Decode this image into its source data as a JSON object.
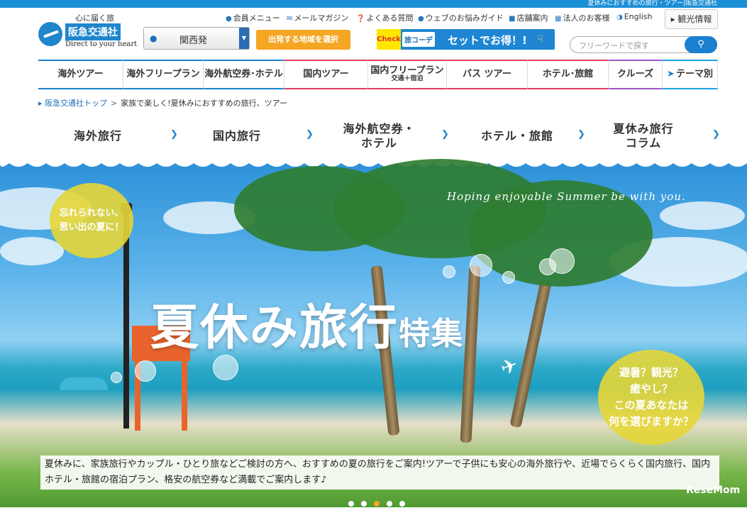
{
  "header": {
    "topbar_text": "夏休みにおすすめの旅行・ツアー|阪急交通社",
    "logo_tagline": "心に届く旅",
    "logo_name": "阪急交通社",
    "logo_english": "Direct to your heart",
    "region_value": "関西発",
    "region_button": "出発する地域を選択",
    "banner_check": "Check",
    "banner_brand": "旅コーデ",
    "banner_text": "セットでお得！!",
    "util_links": [
      "会員メニュー",
      "メールマガジン",
      "よくある質問",
      "ウェブのお悩みガイド",
      "店舗案内",
      "法人のお客様",
      "English"
    ],
    "kanko_button": "観光情報",
    "search_placeholder": "フリーワードで探す"
  },
  "global_nav": [
    {
      "label": "海外ツアー",
      "sub": ""
    },
    {
      "label": "海外フリープラン",
      "sub": ""
    },
    {
      "label": "海外航空券･ホテル",
      "sub": ""
    },
    {
      "label": "国内ツアー",
      "sub": ""
    },
    {
      "label": "国内フリープラン",
      "sub": "交通＋宿泊"
    },
    {
      "label": "バス ツアー",
      "sub": ""
    },
    {
      "label": "ホテル･旅館",
      "sub": ""
    },
    {
      "label": "クルーズ",
      "sub": ""
    },
    {
      "label": "テーマ別",
      "sub": ""
    }
  ],
  "breadcrumb": {
    "home": "阪急交通社トップ",
    "separator": ">",
    "current": "家族で楽しく!夏休みにおすすめの旅行、ツアー"
  },
  "categories": [
    {
      "label": "海外旅行"
    },
    {
      "label": "国内旅行"
    },
    {
      "label": "海外航空券・\nホテル"
    },
    {
      "label": "ホテル・旅館"
    },
    {
      "label": "夏休み旅行\nコラム"
    }
  ],
  "hero": {
    "tagline": "Hoping enjoyable Summer be with you.",
    "balloon_left": "忘れられない、\n思い出の夏に！",
    "balloon_right": "避暑？観光？\n癒やし？\nこの夏あなたは\n何を選びますか？",
    "title_main": "夏休み旅行",
    "title_sub": "特集",
    "description": "夏休みに、家族旅行やカップル・ひとり旅などご検討の方へ、おすすめの夏の旅行をご案内!ツアーで子供にも安心の海外旅行や、近場でらくらく国内旅行、国内ホテル・旅館の宿泊プラン、格安の航空券など満載でご案内します♪",
    "watermark": "ReseMom"
  },
  "colors": {
    "brand_blue": "#1f86cc",
    "accent_orange": "#f5a623",
    "domestic_pink": "#e23b64",
    "balloon_yellow": "#e6d637"
  }
}
